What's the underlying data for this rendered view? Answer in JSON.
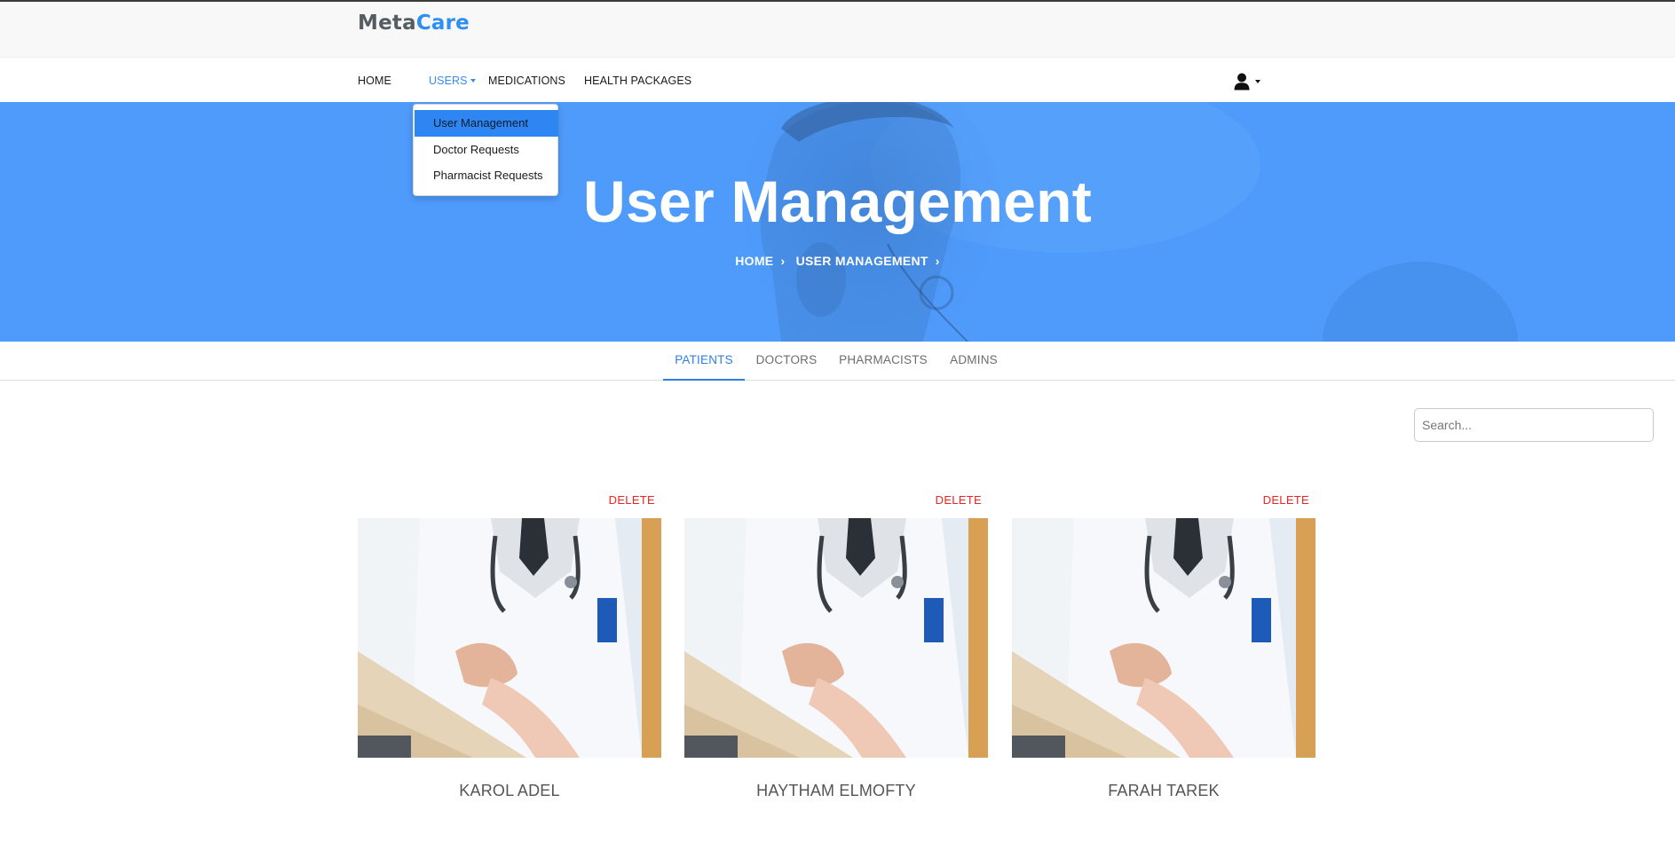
{
  "brand": {
    "part1": "Meta",
    "part2": "Care"
  },
  "nav": {
    "items": [
      {
        "label": "HOME"
      },
      {
        "label": "USERS"
      },
      {
        "label": "MEDICATIONS"
      },
      {
        "label": "HEALTH PACKAGES"
      }
    ],
    "user_icon": "user-icon"
  },
  "dropdown": {
    "items": [
      {
        "label": "User Management"
      },
      {
        "label": "Doctor Requests"
      },
      {
        "label": "Pharmacist Requests"
      }
    ],
    "selected": "User Management"
  },
  "hero": {
    "title": "User Management",
    "breadcrumb": [
      "HOME",
      "USER MANAGEMENT"
    ]
  },
  "tabs": {
    "items": [
      {
        "label": "PATIENTS"
      },
      {
        "label": "DOCTORS"
      },
      {
        "label": "PHARMACISTS"
      },
      {
        "label": "ADMINS"
      }
    ],
    "active": "PATIENTS"
  },
  "search": {
    "placeholder": "Search..."
  },
  "cards": [
    {
      "name": "KAROL ADEL",
      "delete_label": "DELETE"
    },
    {
      "name": "HAYTHAM ELMOFTY",
      "delete_label": "DELETE"
    },
    {
      "name": "FARAH TAREK",
      "delete_label": "DELETE"
    }
  ],
  "colors": {
    "brand_accent": "#2f8ef2",
    "hero_bg": "#4f9bfb",
    "active_link": "#2f7fe0",
    "delete": "#ee2222"
  }
}
